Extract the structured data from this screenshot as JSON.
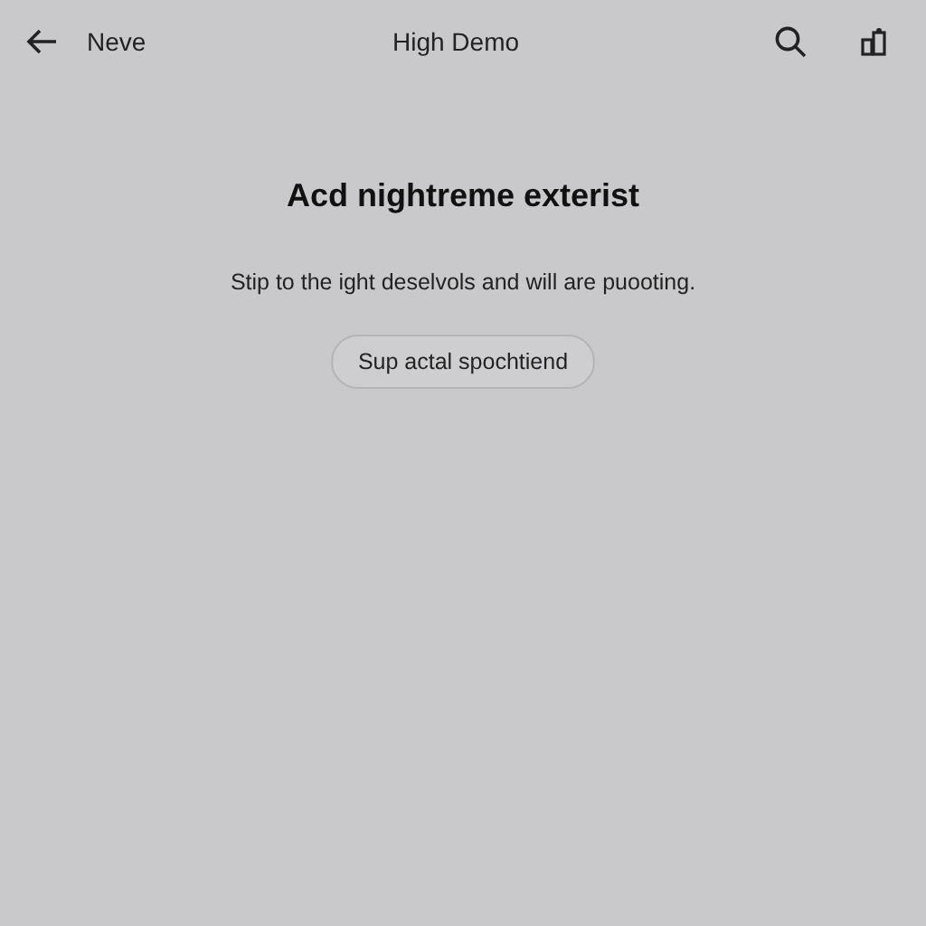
{
  "top_bar": {
    "back_label": "Neve",
    "title": "High Demo"
  },
  "content": {
    "heading": "Acd nightreme exterist",
    "message": "Stip to the ight deselvols and will are puooting.",
    "button": "Sup actal spochtiend"
  }
}
